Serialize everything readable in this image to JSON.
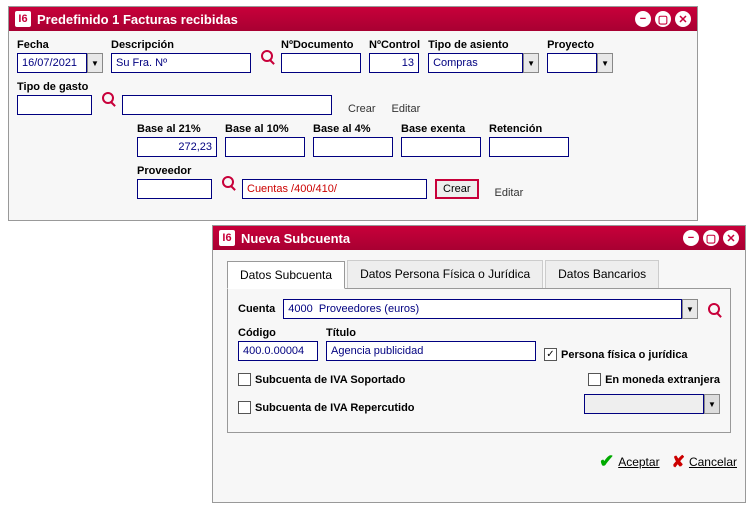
{
  "win1": {
    "title": "Predefinido 1 Facturas recibidas",
    "fields": {
      "fecha_label": "Fecha",
      "fecha": "16/07/2021",
      "descripcion_label": "Descripción",
      "descripcion": "Su Fra. Nº",
      "ndocumento_label": "NºDocumento",
      "ndocumento": "",
      "ncontrol_label": "NºControl",
      "ncontrol": "13",
      "tipo_asiento_label": "Tipo de asiento",
      "tipo_asiento": "Compras",
      "proyecto_label": "Proyecto",
      "proyecto": "",
      "tipo_gasto_label": "Tipo de gasto",
      "tipo_gasto": "",
      "tipo_gasto2": "",
      "crear": "Crear",
      "editar": "Editar",
      "base21_label": "Base al  21%",
      "base21": "272,23",
      "base10_label": "Base al 10%",
      "base10": "",
      "base4_label": "Base al 4%",
      "base4": "",
      "base_exenta_label": "Base exenta",
      "base_exenta": "",
      "retencion_label": "Retención",
      "retencion": "",
      "proveedor_label": "Proveedor",
      "proveedor": "Cuentas /400/410/",
      "crear2": "Crear",
      "editar2": "Editar"
    }
  },
  "win2": {
    "title": "Nueva Subcuenta",
    "tabs": {
      "t1": "Datos Subcuenta",
      "t2": "Datos Persona Física o Jurídica",
      "t3": "Datos Bancarios"
    },
    "fields": {
      "cuenta_label": "Cuenta",
      "cuenta": "4000  Proveedores (euros)",
      "codigo_label": "Código",
      "codigo": "400.0.00004",
      "titulo_label": "Título",
      "titulo": "Agencia publicidad",
      "persona_label": "Persona física o jurídica",
      "sub_iva_sop": "Subcuenta de IVA Soportado",
      "sub_iva_rep": "Subcuenta de IVA Repercutido",
      "moneda_label": "En moneda extranjera",
      "moneda_val": ""
    },
    "footer": {
      "aceptar": "Aceptar",
      "cancelar": "Cancelar"
    }
  }
}
